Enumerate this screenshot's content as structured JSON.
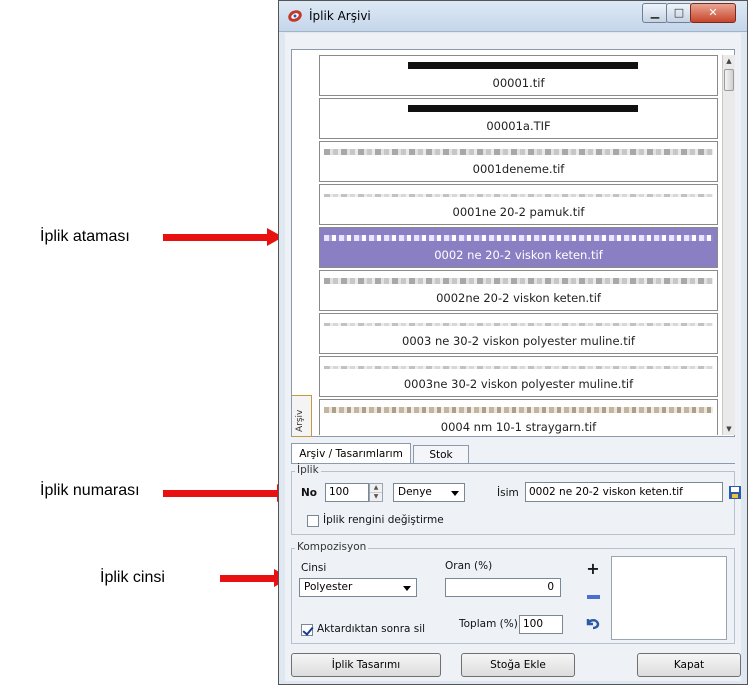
{
  "annotations": {
    "iplik_atamasi": "İplik ataması",
    "iplik_numarasi": "İplik numarası",
    "iplik_cinsi": "İplik cinsi"
  },
  "window": {
    "title": "İplik Arşivi",
    "side_tab": "Arşiv"
  },
  "files": [
    {
      "name": "00001.tif",
      "pattern": "black"
    },
    {
      "name": "00001a.TIF",
      "pattern": "black"
    },
    {
      "name": "0001deneme.tif",
      "pattern": "gray"
    },
    {
      "name": "0001ne 20-2 pamuk.tif",
      "pattern": "thin"
    },
    {
      "name": "0002 ne 20-2 viskon keten.tif",
      "pattern": "gray",
      "selected": true
    },
    {
      "name": "0002ne 20-2 viskon keten.tif",
      "pattern": "gray"
    },
    {
      "name": "0003 ne 30-2 viskon polyester muline.tif",
      "pattern": "thin"
    },
    {
      "name": "0003ne 30-2 viskon polyester muline.tif",
      "pattern": "thin"
    },
    {
      "name": "0004 nm 10-1 straygarn.tif",
      "pattern": "tan"
    },
    {
      "name": "",
      "pattern": "tan"
    }
  ],
  "tabs": [
    "Arşiv / Tasarımlarım",
    "Stok"
  ],
  "iplik": {
    "group_label": "İplik",
    "no_label": "No",
    "no_value": "100",
    "unit": "Denye",
    "isim_label": "İsim",
    "isim_value": "0002 ne 20-2 viskon keten.tif",
    "keep_color_label": "İplik rengini değiştirme"
  },
  "kompozisyon": {
    "group_label": "Kompozisyon",
    "cinsi_label": "Cinsi",
    "cinsi_value": "Polyester",
    "oran_label": "Oran (%)",
    "oran_value": "0",
    "delete_after_label": "Aktardıktan sonra sil",
    "toplam_label": "Toplam (%)",
    "toplam_value": "100"
  },
  "buttons": {
    "design": "İplik Tasarımı",
    "add_stock": "Stoğa Ekle",
    "close": "Kapat"
  },
  "colors": {
    "arrow": "#e81010",
    "selection": "#8b7fc4"
  }
}
